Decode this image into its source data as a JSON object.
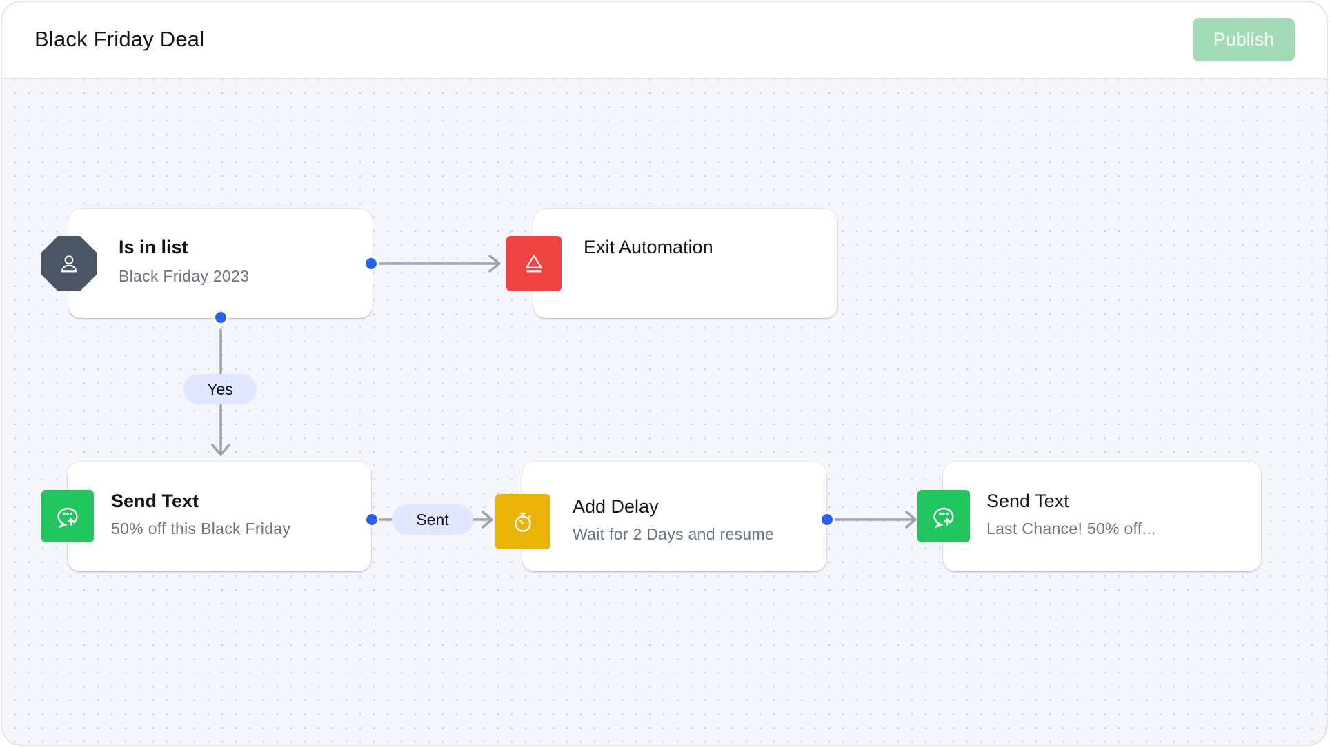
{
  "header": {
    "title": "Black Friday Deal",
    "publish_label": "Publish"
  },
  "colors": {
    "accent": "#2563eb",
    "publish": "#a3dbb8",
    "exit": "#ef4444",
    "send_text": "#22c55e",
    "delay": "#eab308",
    "condition": "#4b5563",
    "pill": "#e0e7ff",
    "connector": "#9ca3af"
  },
  "nodes": [
    {
      "id": "is-in-list",
      "title": "Is in list",
      "subtitle": "Black Friday 2023",
      "icon": "user-icon"
    },
    {
      "id": "exit-automation",
      "title": "Exit Automation",
      "subtitle": "",
      "icon": "eject-icon"
    },
    {
      "id": "send-text-1",
      "title": "Send Text",
      "subtitle": "50% off this Black Friday",
      "icon": "chat-send-icon"
    },
    {
      "id": "add-delay",
      "title": "Add Delay",
      "subtitle": "Wait for 2 Days and resume",
      "icon": "stopwatch-icon"
    },
    {
      "id": "send-text-2",
      "title": "Send Text",
      "subtitle": "Last Chance! 50% off...",
      "icon": "chat-send-icon"
    }
  ],
  "edges": [
    {
      "from": "is-in-list",
      "to": "exit-automation",
      "label": ""
    },
    {
      "from": "is-in-list",
      "to": "send-text-1",
      "label": "Yes"
    },
    {
      "from": "send-text-1",
      "to": "add-delay",
      "label": "Sent"
    },
    {
      "from": "add-delay",
      "to": "send-text-2",
      "label": ""
    }
  ]
}
